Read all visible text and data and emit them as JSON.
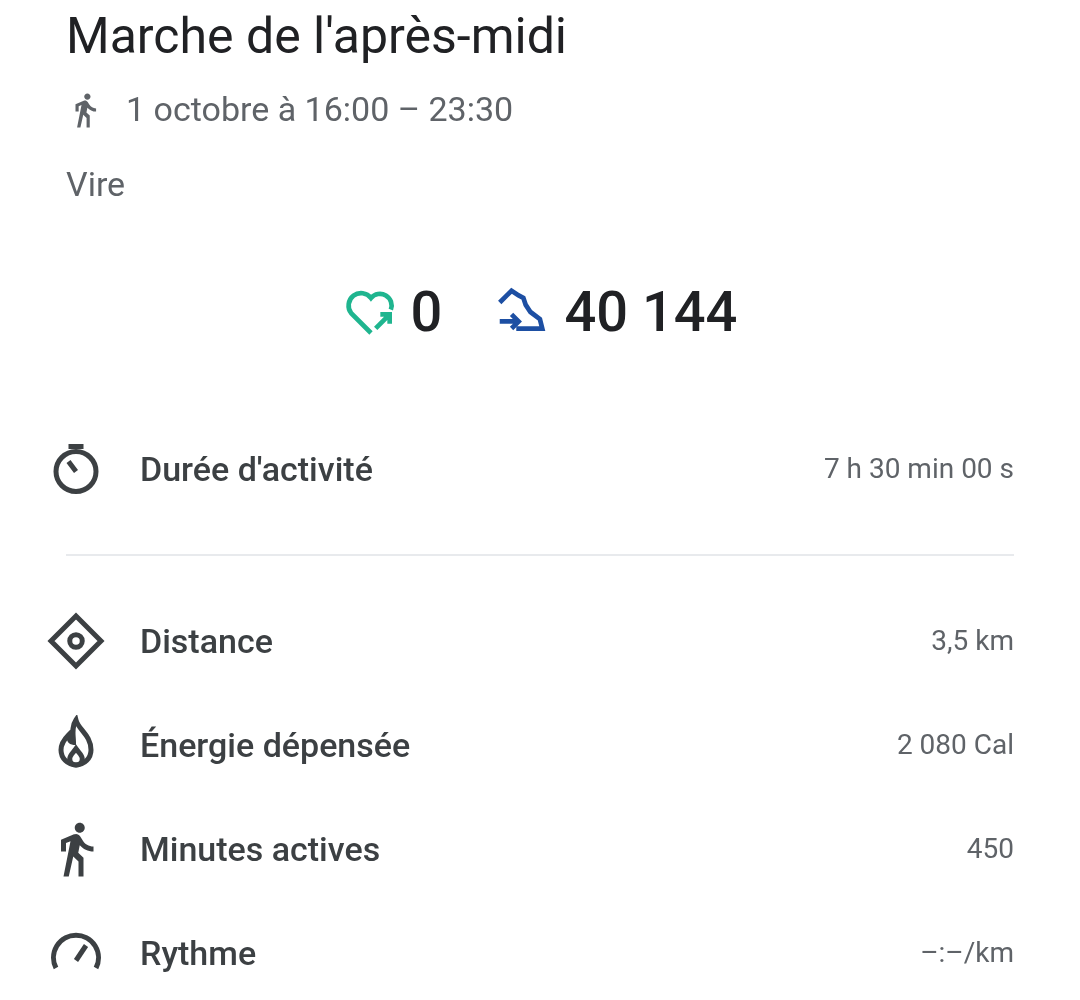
{
  "title": "Marche de l'après-midi",
  "time": "1 octobre à 16:00 – 23:30",
  "location": "Vire",
  "summary": [
    {
      "kind": "heart_points",
      "value": "0"
    },
    {
      "kind": "steps",
      "value": "40 144"
    }
  ],
  "sections": [
    {
      "rows": [
        {
          "kind": "duration",
          "label": "Durée d'activité",
          "value": "7 h 30 min 00 s"
        }
      ]
    },
    {
      "rows": [
        {
          "kind": "distance",
          "label": "Distance",
          "value": "3,5 km"
        },
        {
          "kind": "energy",
          "label": "Énergie dépensée",
          "value": "2 080 Cal"
        },
        {
          "kind": "active",
          "label": "Minutes actives",
          "value": "450"
        },
        {
          "kind": "pace",
          "label": "Rythme",
          "value": "–:–/km"
        }
      ]
    }
  ]
}
